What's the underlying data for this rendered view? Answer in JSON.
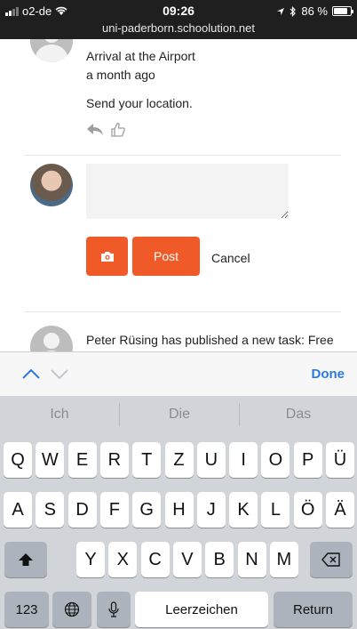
{
  "status_bar": {
    "carrier": "o2-de",
    "time": "09:26",
    "battery": "86 %",
    "battery_level": 0.86,
    "url": "uni-paderborn.schoolution.net"
  },
  "feed": {
    "post_title": "Arrival at the Airport",
    "post_time": "a month ago",
    "post_body": "Send your location.",
    "next_item_text": "Peter Rüsing has published a new task: Free"
  },
  "compose": {
    "input_value": "",
    "post_label": "Post",
    "cancel_label": "Cancel"
  },
  "accessory": {
    "done_label": "Done"
  },
  "keyboard": {
    "suggestions": [
      "Ich",
      "Die",
      "Das"
    ],
    "row1": [
      "Q",
      "W",
      "E",
      "R",
      "T",
      "Z",
      "U",
      "I",
      "O",
      "P",
      "Ü"
    ],
    "row2": [
      "A",
      "S",
      "D",
      "F",
      "G",
      "H",
      "J",
      "K",
      "L",
      "Ö",
      "Ä"
    ],
    "row3": [
      "Y",
      "X",
      "C",
      "V",
      "B",
      "N",
      "M"
    ],
    "numbers_label": "123",
    "space_label": "Leerzeichen",
    "return_label": "Return"
  },
  "icons": {
    "reply": "reply-icon",
    "like": "thumbs-up-icon",
    "camera": "camera-icon",
    "shift": "shift-icon",
    "backspace": "backspace-icon",
    "globe": "globe-icon",
    "mic": "microphone-icon"
  },
  "colors": {
    "accent": "#f05a28",
    "link": "#2a7ae2",
    "keyboard_bg": "#d1d4d9"
  }
}
